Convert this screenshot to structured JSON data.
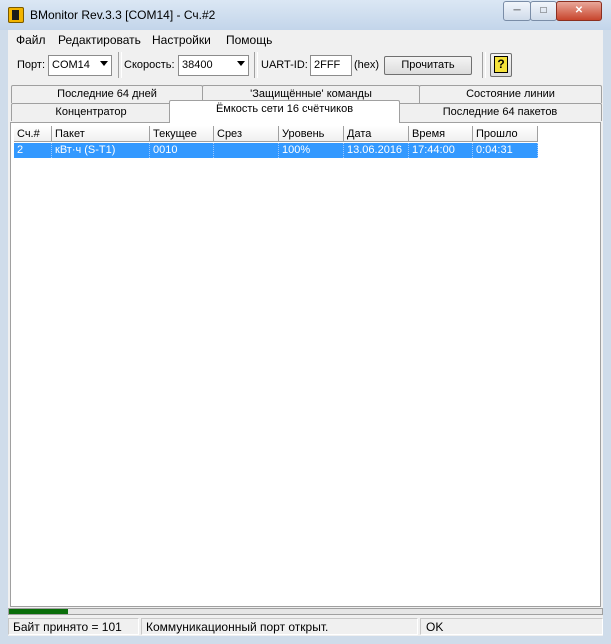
{
  "window": {
    "title": "BMonitor Rev.3.3 [COM14] - Сч.#2",
    "minimize": "─",
    "maximize": "□",
    "close": "✕"
  },
  "menu": [
    "Файл",
    "Редактировать",
    "Настройки",
    "Помощь"
  ],
  "toolbar": {
    "port_label": "Порт:",
    "port_value": "COM14",
    "speed_label": "Скорость:",
    "speed_value": "38400",
    "uart_label": "UART-ID:",
    "uart_value": "2FFF",
    "hex_label": "(hex)",
    "read_button": "Прочитать",
    "help_button": "?"
  },
  "tabs": {
    "row1": [
      "Последние 64 дней",
      "'Защищённые' команды",
      "Состояние линии"
    ],
    "row2": [
      "Концентратор",
      "Ёмкость сети 16 счётчиков",
      "Последние 64 пакетов"
    ],
    "active": "Ёмкость сети 16 счётчиков"
  },
  "table": {
    "columns": [
      "Сч.#",
      "Пакет",
      "Текущее",
      "Срез",
      "Уровень",
      "Дата",
      "Время",
      "Прошло"
    ],
    "rows": [
      [
        "2",
        "кВт·ч (S-T1)",
        "0010",
        "",
        "100%",
        "13.06.2016",
        "17:44:00",
        "0:04:31"
      ]
    ]
  },
  "progress": {
    "value_fraction": 0.1
  },
  "status": {
    "bytes": "Байт принято = 101",
    "port_state": "Коммуникационный порт открыт.",
    "ok": "OK"
  },
  "colors": {
    "selection": "#3399ff",
    "progress": "#0b6e0b",
    "frame": "#cfdcea"
  }
}
